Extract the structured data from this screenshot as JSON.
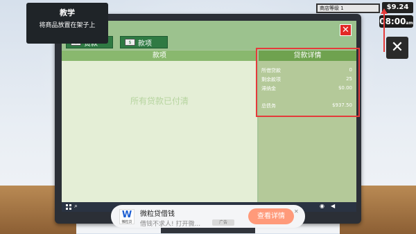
{
  "tutorial": {
    "title": "教学",
    "text": "将商品放置在架子上"
  },
  "hud": {
    "store_level": "商店等级 1",
    "money": "$9.24",
    "time": "08:00",
    "time_suffix": "am"
  },
  "window": {
    "close_glyph": "✕",
    "tabs": [
      {
        "label": "贷款",
        "icon": "cash-icon"
      },
      {
        "label": "款项",
        "icon": "cash-icon"
      }
    ],
    "left_panel": {
      "header": "款项",
      "empty_message": "所有贷款已付清"
    },
    "right_panel": {
      "header": "贷款详情",
      "rows": [
        {
          "label": "所借贷款",
          "value": "0"
        },
        {
          "label": "剩余款项",
          "value": "25"
        },
        {
          "label": "滞纳金",
          "value": "$0.00"
        }
      ],
      "total": {
        "label": "总债务",
        "value": "$937.50"
      }
    }
  },
  "taskbar": {
    "search_glyph": "⌕",
    "wifi_glyph": "◉",
    "volume_glyph": "◀"
  },
  "ad": {
    "logo_text": "W",
    "logo_sub": "微粒贷",
    "title": "微粒贷借钱",
    "subtitle": "借钱不求人! 打开微...",
    "tag": "广告",
    "button": "查看详情",
    "close_glyph": "✕"
  },
  "exit_button_glyph": "✕",
  "colors": {
    "accent_red": "#e53a3a",
    "panel_green": "#6fa24f",
    "close_red": "#e32826"
  }
}
